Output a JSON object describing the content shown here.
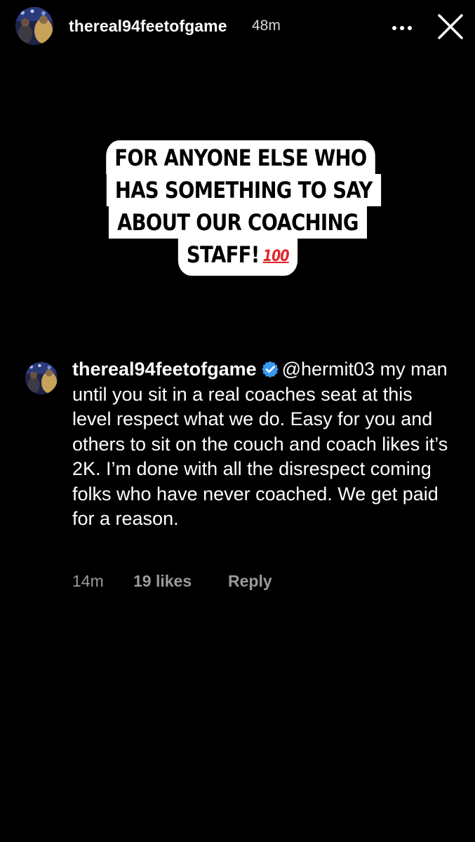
{
  "header": {
    "username": "thereal94feetofgame",
    "time": "48m",
    "more_icon": "more-horizontal-icon",
    "close_icon": "close-icon"
  },
  "sticker": {
    "lines": [
      "FOR ANYONE ELSE WHO",
      "HAS SOMETHING TO SAY",
      "ABOUT OUR COACHING",
      "STAFF!"
    ],
    "emoji": "💯",
    "background": "#ffffff",
    "text_color": "#000000",
    "emoji_color": "#e0242b"
  },
  "comment": {
    "username": "thereal94feetofgame",
    "verified_icon": "verified-badge-icon",
    "verified_color": "#3897f0",
    "mention": "@hermit03",
    "text": "my man until you sit in a real coaches seat at this level respect what we do.  Easy for you and others to sit on the couch and coach likes it’s 2K.  I’m done with all the disrespect coming folks who have never coached.  We get paid for a reason.",
    "time": "14m",
    "likes": "19 likes",
    "reply": "Reply"
  }
}
